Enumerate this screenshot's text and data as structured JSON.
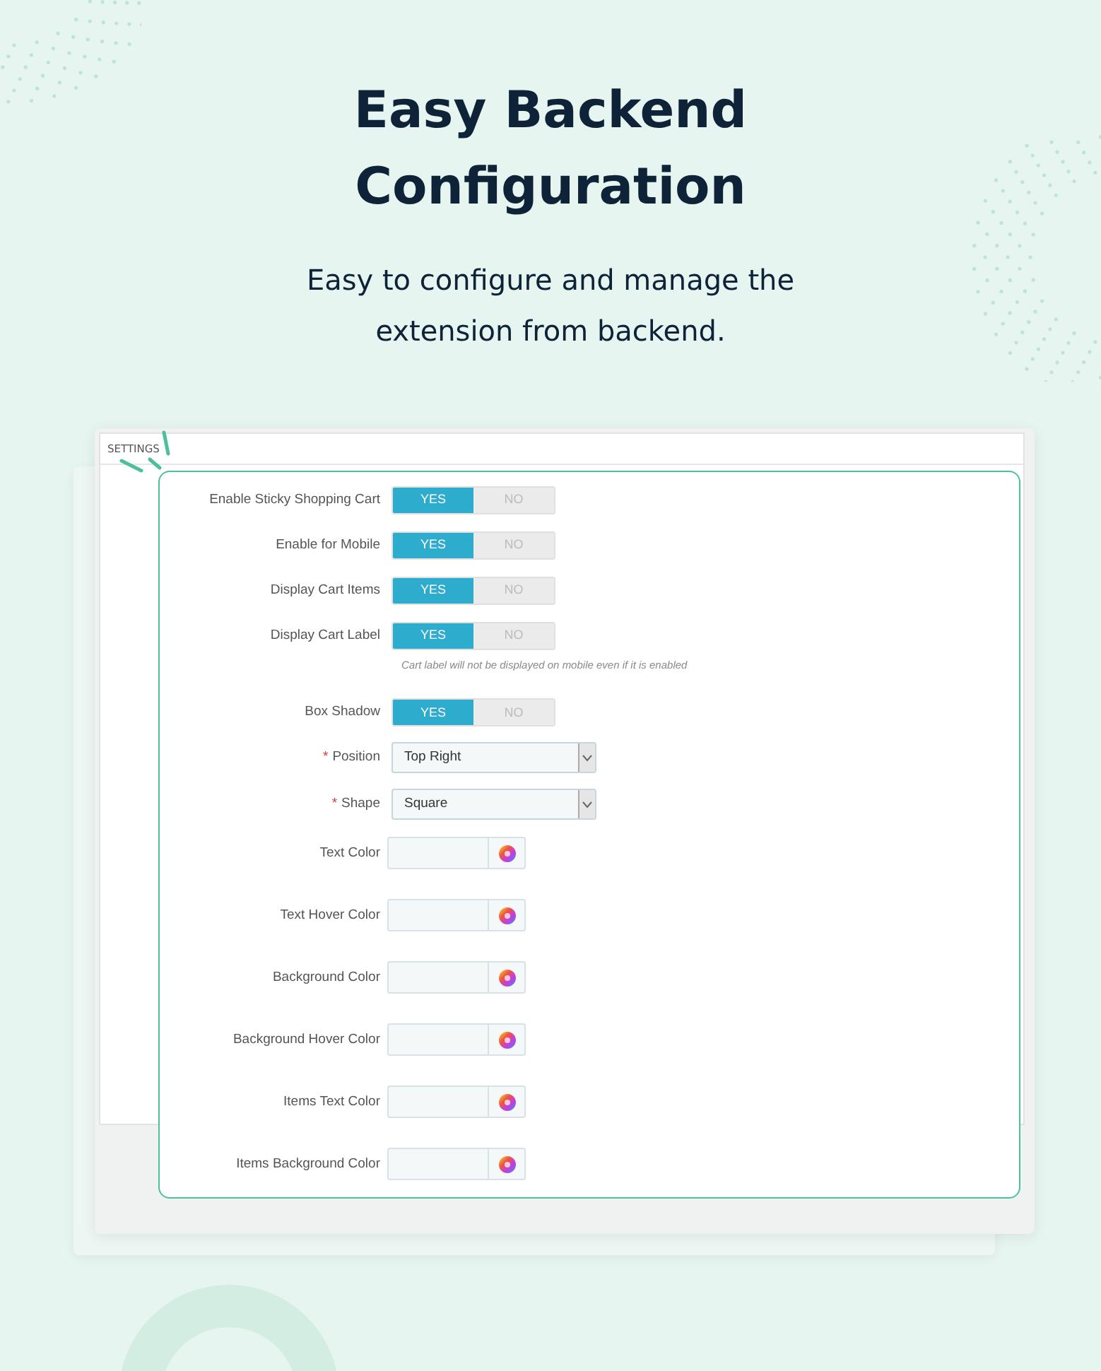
{
  "heading": "Easy Backend Configuration",
  "subheading": "Easy to configure and manage the extension from backend.",
  "window": {
    "title": "SETTINGS"
  },
  "fields": [
    {
      "kind": "toggle",
      "label": "Enable Sticky Shopping Cart",
      "options": [
        {
          "label": "YES",
          "selected": true
        },
        {
          "label": "NO",
          "selected": false
        }
      ]
    },
    {
      "kind": "toggle",
      "label": "Enable for Mobile",
      "options": [
        {
          "label": "YES",
          "selected": true
        },
        {
          "label": "NO",
          "selected": false
        }
      ]
    },
    {
      "kind": "toggle",
      "label": "Display Cart Items",
      "options": [
        {
          "label": "YES",
          "selected": true
        },
        {
          "label": "NO",
          "selected": false
        }
      ]
    },
    {
      "kind": "toggle",
      "label": "Display Cart Label",
      "options": [
        {
          "label": "YES",
          "selected": true
        },
        {
          "label": "NO",
          "selected": false
        }
      ],
      "hint": "Cart label will not be displayed on mobile even if it is enabled"
    },
    {
      "kind": "toggle",
      "label": "Box Shadow",
      "options": [
        {
          "label": "YES",
          "selected": true
        },
        {
          "label": "NO",
          "selected": false
        }
      ]
    },
    {
      "kind": "select",
      "label": "Position",
      "required_mark": "*",
      "value": "Top Right"
    },
    {
      "kind": "select",
      "label": "Shape",
      "required_mark": "*",
      "value": "Square"
    },
    {
      "kind": "color",
      "label": "Text Color"
    },
    {
      "kind": "color",
      "label": "Text Hover Color"
    },
    {
      "kind": "color",
      "label": "Background Color"
    },
    {
      "kind": "color",
      "label": "Background Hover Color"
    },
    {
      "kind": "color",
      "label": "Items Text Color"
    },
    {
      "kind": "color",
      "label": "Items Background Color"
    }
  ]
}
